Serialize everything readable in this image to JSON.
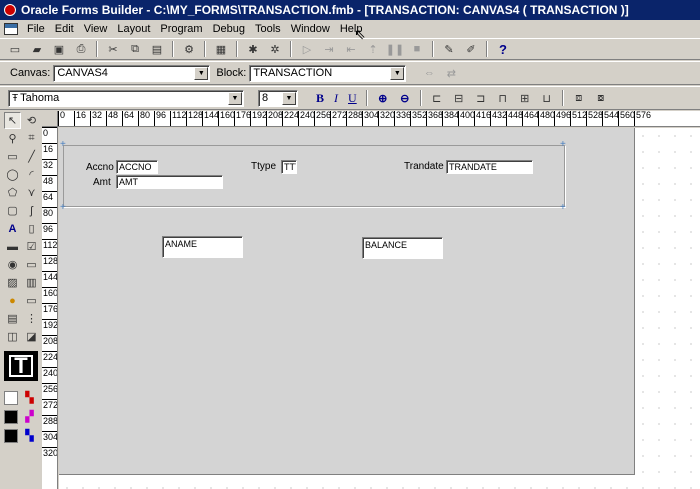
{
  "window": {
    "title": "Oracle Forms Builder - C:\\MY_FORMS\\TRANSACTION.fmb - [TRANSACTION: CANVAS4 ( TRANSACTION )]"
  },
  "menu": [
    "File",
    "Edit",
    "View",
    "Layout",
    "Program",
    "Debug",
    "Tools",
    "Window",
    "Help"
  ],
  "toolbar": {
    "canvas_label": "Canvas:",
    "canvas_value": "CANVAS4",
    "block_label": "Block:",
    "block_value": "TRANSACTION",
    "font_value": "Tahoma",
    "size_value": "8",
    "bold": "B",
    "italic": "I",
    "underline": "U",
    "help": "?"
  },
  "ruler": {
    "h": [
      "0",
      "16",
      "32",
      "48",
      "64",
      "80",
      "96",
      "112",
      "128",
      "144",
      "160",
      "176",
      "192",
      "208",
      "224",
      "240",
      "256",
      "272",
      "288",
      "304",
      "320",
      "336",
      "352",
      "368",
      "384",
      "400",
      "416",
      "432",
      "448",
      "464",
      "480",
      "496",
      "512",
      "528",
      "544",
      "560",
      "576"
    ],
    "v": [
      "0",
      "16",
      "32",
      "48",
      "64",
      "80",
      "96",
      "112",
      "128",
      "144",
      "160",
      "176",
      "192",
      "208",
      "224",
      "240",
      "256",
      "272",
      "288",
      "304",
      "320"
    ]
  },
  "canvas": {
    "prompts": {
      "accno": "Accno",
      "amt": "Amt",
      "ttype": "Ttype",
      "trandate": "Trandate"
    },
    "fields": {
      "accno": "ACCNO",
      "amt": "AMT",
      "ttype": "TTYPE",
      "trandate": "TRANDATE",
      "aname": "ANAME",
      "balance": "BALANCE"
    }
  }
}
